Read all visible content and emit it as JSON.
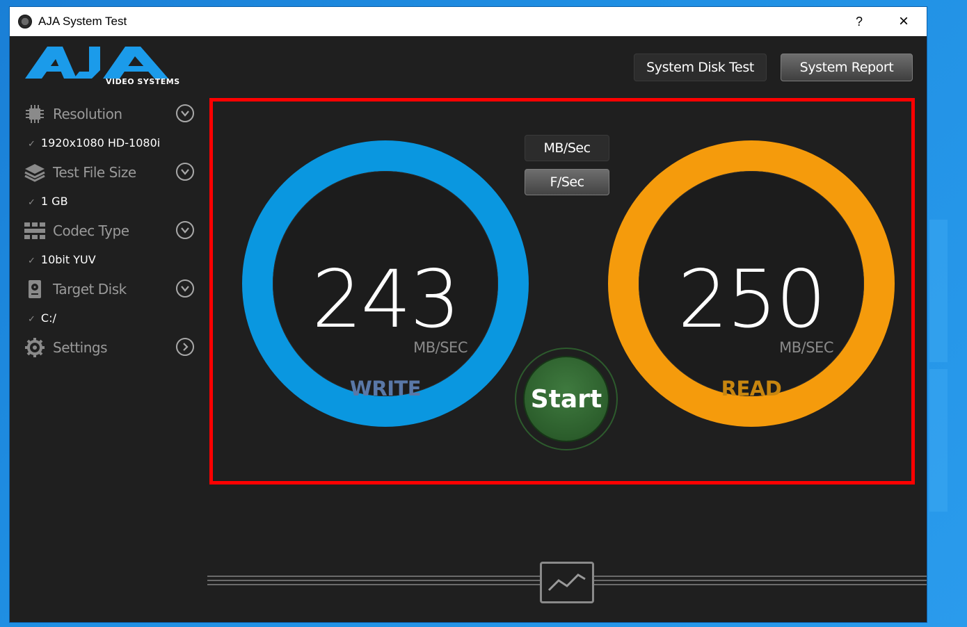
{
  "window": {
    "title": "AJA System Test",
    "help_label": "?",
    "close_label": "×"
  },
  "logo": {
    "text": "AJA",
    "subtitle": "VIDEO SYSTEMS"
  },
  "header": {
    "system_disk_test_label": "System Disk Test",
    "system_report_label": "System Report"
  },
  "sidebar": {
    "items": [
      {
        "label": "Resolution",
        "value": "1920x1080 HD-1080i",
        "icon": "chip-icon"
      },
      {
        "label": "Test File Size",
        "value": "1 GB",
        "icon": "stack-icon"
      },
      {
        "label": "Codec Type",
        "value": "10bit YUV",
        "icon": "grid-icon"
      },
      {
        "label": "Target Disk",
        "value": "C:/",
        "icon": "disk-icon"
      },
      {
        "label": "Settings",
        "value": "",
        "icon": "gear-icon"
      }
    ],
    "check": "✓"
  },
  "units": {
    "mb_label": "MB/Sec",
    "f_label": "F/Sec"
  },
  "write": {
    "value": "243",
    "unit": "MB/SEC",
    "label": "WRITE",
    "color": "#0a97e0",
    "label_color": "#5a78a8"
  },
  "read": {
    "value": "250",
    "unit": "MB/SEC",
    "label": "READ",
    "color": "#f59b0c",
    "label_color": "#c8860f"
  },
  "start": {
    "label": "Start"
  },
  "colors": {
    "highlight": "#ff0000",
    "logo_blue": "#1b9bea",
    "start_green": "#2c5e2c"
  }
}
